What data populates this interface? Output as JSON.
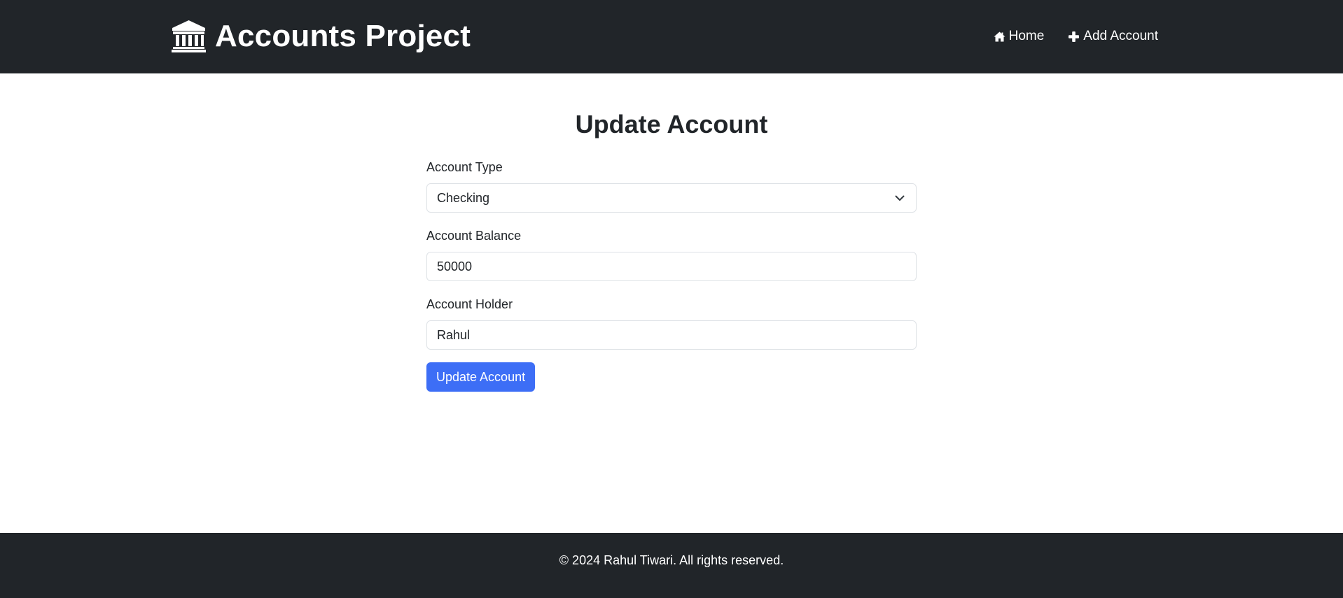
{
  "header": {
    "brand_title": "Accounts Project",
    "brand_icon": "bank-icon",
    "nav": [
      {
        "label": "Home",
        "icon": "home-icon"
      },
      {
        "label": "Add Account",
        "icon": "plus-icon"
      }
    ]
  },
  "main": {
    "title": "Update Account",
    "fields": {
      "account_type": {
        "label": "Account Type",
        "value": "Checking"
      },
      "account_balance": {
        "label": "Account Balance",
        "value": "50000"
      },
      "account_holder": {
        "label": "Account Holder",
        "value": "Rahul"
      }
    },
    "submit_label": "Update Account"
  },
  "footer": {
    "text": "© 2024 Rahul Tiwari. All rights reserved."
  },
  "colors": {
    "navbar_bg": "#212529",
    "primary": "#3d6ef6",
    "text": "#212529",
    "border": "#dee2e6"
  }
}
